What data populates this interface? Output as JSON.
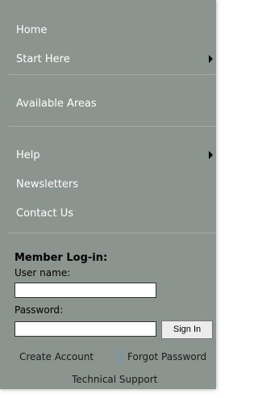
{
  "nav": {
    "home": "Home",
    "start_here": "Start Here",
    "available_areas": "Available Areas",
    "help": "Help",
    "newsletters": "Newsletters",
    "contact_us": "Contact Us"
  },
  "login": {
    "title": "Member Log-in:",
    "username_label": "User name:",
    "username_value": "",
    "password_label": "Password:",
    "password_value": "",
    "sign_in_label": "Sign In"
  },
  "links": {
    "create_account": "Create Account",
    "forgot_password": "Forgot Password",
    "technical_support": "Technical Support"
  },
  "colors": {
    "panel_background": "#8c948f",
    "nav_text": "#ffffff"
  }
}
